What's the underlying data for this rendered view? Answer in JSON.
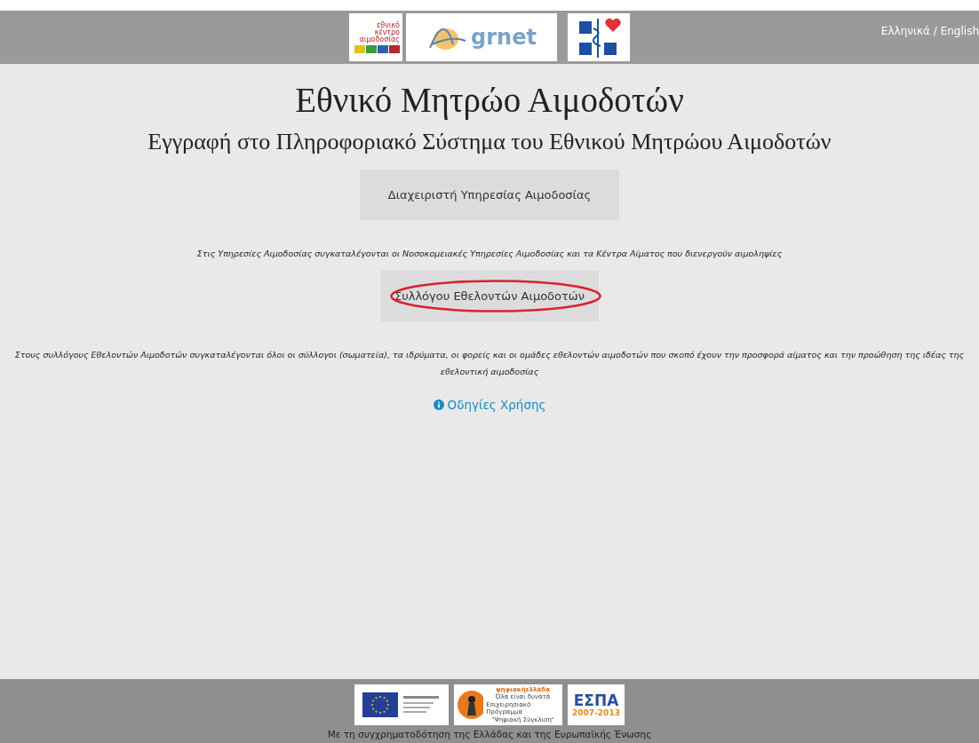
{
  "header": {
    "logos": [
      {
        "kind": "blood-center",
        "lines": [
          "εθνικό",
          "κέντρο",
          "αιμοδοσίας"
        ]
      },
      {
        "kind": "grnet",
        "text": "grnet"
      },
      {
        "kind": "ministry"
      }
    ],
    "language_link": "Ελληνικά / English"
  },
  "title": "Εθνικό Μητρώο Αιμοδοτών",
  "subtitle": "Εγγραφή στο Πληροφοριακό Σύστημα του Εθνικού Μητρώου Αιμοδοτών",
  "sections": [
    {
      "button": "Διαχειριστή Υπηρεσίας Αιμοδοσίας",
      "circled": false,
      "note": "Στις Υπηρεσίες Αιμοδοσίας συγκαταλέγονται οι Νοσοκομειακές Υπηρεσίες Αιμοδοσίας και τα Κέντρα Αίματος που διενεργούν αιμοληψίες"
    },
    {
      "button": "Συλλόγου Εθελοντών Αιμοδοτών",
      "circled": true,
      "note": "Στους συλλόγους Εθελοντών Αιμοδοτών συγκαταλέγονται όλοι οι σύλλογοι (σωματεία), τα ιδρύματα, οι φορείς και οι ομάδες εθελοντών αιμοδοτών που σκοπό έχουν την προσφορά αίματος και την προώθηση της ιδέας της εθελοντική αιμοδοσίας"
    }
  ],
  "help_link": "Οδηγίες Χρήσης",
  "footer": {
    "logos": [
      {
        "kind": "eu"
      },
      {
        "kind": "digital-greece",
        "lines": [
          "ψηφιακήελλάδα",
          "Όλα είναι δυνατά",
          "Επιχειρησιακό Πρόγραμμα",
          "\"Ψηφιακή Σύγκλιση\""
        ]
      },
      {
        "kind": "espa",
        "lines": [
          "ΕΣΠΑ",
          "2007-2013"
        ]
      }
    ],
    "caption": "Με τη συγχρηματοδότηση της Ελλάδας και της Ευρωπαϊκής Ένωσης"
  }
}
